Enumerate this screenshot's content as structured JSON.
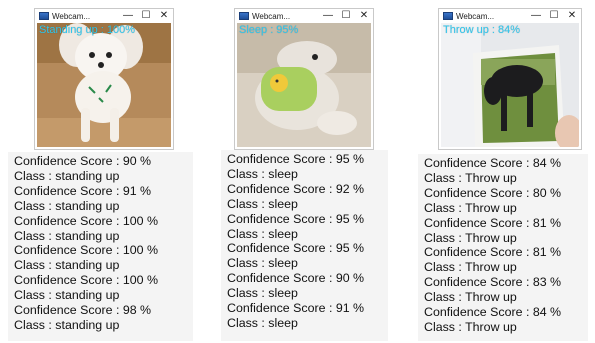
{
  "windows": [
    {
      "title": "Webcam...",
      "overlay": "Standing up : 100%",
      "overlay_color": "#2ec7ee",
      "log": [
        "Confidence Score : 90 %",
        "Class : standing up",
        "Confidence Score : 91 %",
        "Class : standing up",
        "Confidence Score : 100 %",
        "Class : standing up",
        "Confidence Score : 100 %",
        "Class : standing up",
        "Confidence Score : 100 %",
        "Class : standing up",
        "Confidence Score : 98 %",
        "Class : standing up"
      ]
    },
    {
      "title": "Webcam...",
      "overlay": "Sleep : 95%",
      "overlay_color": "#2ec7ee",
      "log": [
        "Confidence Score : 95 %",
        "Class : sleep",
        "Confidence Score : 92 %",
        "Class : sleep",
        "Confidence Score : 95 %",
        "Class : sleep",
        "Confidence Score : 95 %",
        "Class : sleep",
        "Confidence Score : 90 %",
        "Class : sleep",
        "Confidence Score : 91 %",
        "Class : sleep"
      ]
    },
    {
      "title": "Webcam...",
      "overlay": "Throw up : 84%",
      "overlay_color": "#2ec7ee",
      "log": [
        "Confidence Score : 84 %",
        "Class : Throw up",
        "Confidence Score : 80 %",
        "Class : Throw up",
        "Confidence Score : 81 %",
        "Class : Throw up",
        "Confidence Score : 81 %",
        "Class : Throw up",
        "Confidence Score : 83 %",
        "Class : Throw up",
        "Confidence Score : 84 %",
        "Class : Throw up"
      ]
    }
  ],
  "controls": {
    "minimize": "—",
    "maximize": "☐",
    "close": "✕"
  }
}
